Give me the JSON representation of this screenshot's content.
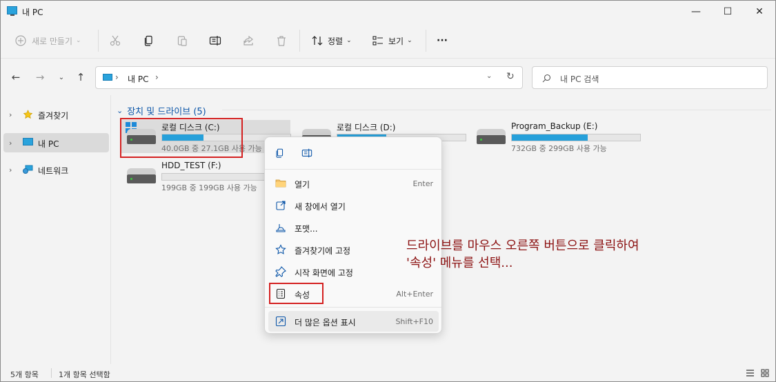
{
  "window": {
    "title": "내 PC",
    "minimize": "—",
    "maximize": "☐",
    "close": "✕"
  },
  "toolbar": {
    "new_label": "새로 만들기",
    "sort_label": "정렬",
    "view_label": "보기",
    "more_label": "···"
  },
  "nav": {
    "address": "내 PC",
    "address_sep1": "›",
    "address_sep2": "›",
    "search_placeholder": "내 PC 검색"
  },
  "sidebar": {
    "items": [
      {
        "label": "즐겨찾기"
      },
      {
        "label": "내 PC"
      },
      {
        "label": "네트워크"
      }
    ]
  },
  "main": {
    "group_title": "장치 및 드라이브 (5)",
    "drives": [
      {
        "name": "로컬 디스크 (C:)",
        "info": "40.0GB 중 27.1GB 사용 가능",
        "used": 0.32
      },
      {
        "name": "로컬 디스크 (D:)",
        "info": "",
        "used": 0.38
      },
      {
        "name": "Program_Backup (E:)",
        "info": "732GB 중 299GB 사용 가능",
        "used": 0.59
      },
      {
        "name": "HDD_TEST (F:)",
        "info": "199GB 중 199GB 사용 가능",
        "used": 0.0
      }
    ]
  },
  "context_menu": {
    "items": [
      {
        "label": "열기",
        "shortcut": "Enter"
      },
      {
        "label": "새 창에서 열기",
        "shortcut": ""
      },
      {
        "label": "포맷...",
        "shortcut": ""
      },
      {
        "label": "즐겨찾기에 고정",
        "shortcut": ""
      },
      {
        "label": "시작 화면에 고정",
        "shortcut": ""
      },
      {
        "label": "속성",
        "shortcut": "Alt+Enter"
      },
      {
        "label": "더 많은 옵션 표시",
        "shortcut": "Shift+F10"
      }
    ]
  },
  "annotation": {
    "line1": "드라이브를 마우스 오른쪽 버튼으로 클릭하여",
    "line2": "'속성' 메뉴를 선택..."
  },
  "status": {
    "count": "5개 항목",
    "selected": "1개 항목 선택함"
  },
  "colors": {
    "accent": "#0b55a8",
    "bar_fill": "#26a0da",
    "highlight_box": "#d42020",
    "annotation": "#8b1010"
  }
}
